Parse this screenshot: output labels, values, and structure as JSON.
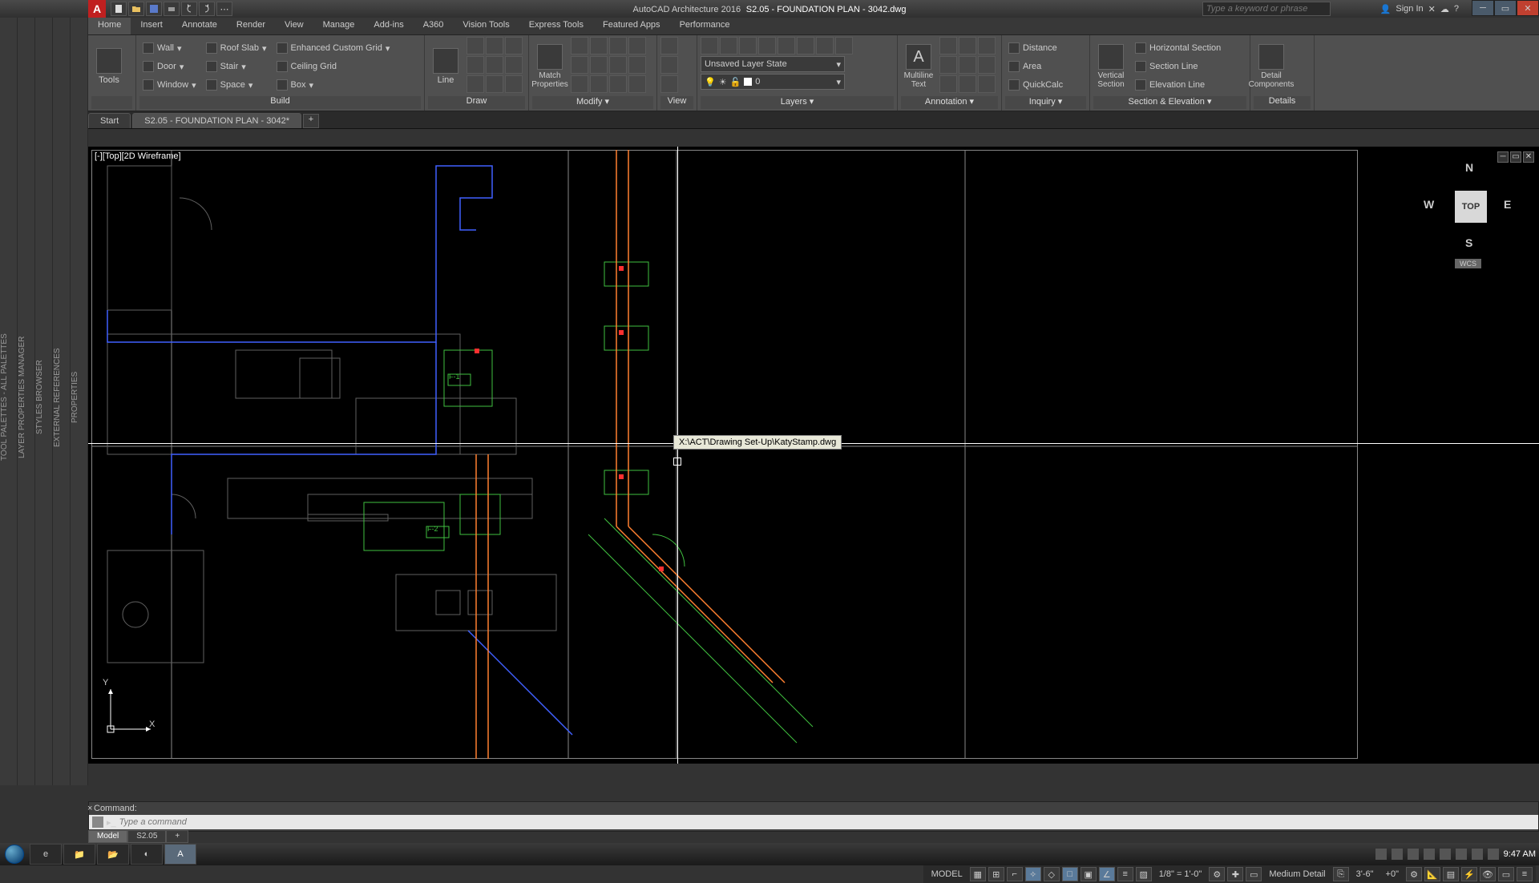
{
  "app": {
    "product": "AutoCAD Architecture 2016",
    "document": "S2.05 - FOUNDATION PLAN - 3042.dwg",
    "search_placeholder": "Type a keyword or phrase",
    "sign_in": "Sign In"
  },
  "ribbon": {
    "tabs": [
      "Home",
      "Insert",
      "Annotate",
      "Render",
      "View",
      "Manage",
      "Add-ins",
      "A360",
      "Vision Tools",
      "Express Tools",
      "Featured Apps",
      "Performance"
    ],
    "active_tab": "Home",
    "panels": {
      "tools": {
        "title": "",
        "big": "Tools"
      },
      "build": {
        "title": "Build",
        "rows": [
          [
            "Wall",
            "Roof Slab",
            "Enhanced Custom Grid"
          ],
          [
            "Door",
            "Stair",
            "Ceiling Grid"
          ],
          [
            "Window",
            "Space",
            "Box"
          ]
        ]
      },
      "draw": {
        "title": "Draw",
        "big": "Line"
      },
      "modify": {
        "title": "Modify ▾",
        "big": "Match Properties"
      },
      "view": {
        "title": "View"
      },
      "layers": {
        "title": "Layers ▾",
        "state": "Unsaved Layer State",
        "current": "0",
        "swatch": "#ffffff"
      },
      "annotation": {
        "title": "Annotation ▾",
        "big": "Multiline Text"
      },
      "inquiry": {
        "title": "Inquiry ▾",
        "items": [
          "Distance",
          "Area",
          "QuickCalc"
        ]
      },
      "section": {
        "title": "Section & Elevation ▾",
        "big": "Vertical Section",
        "items": [
          "Horizontal Section",
          "Section Line",
          "Elevation Line"
        ]
      },
      "details": {
        "title": "Details",
        "big": "Detail Components"
      }
    }
  },
  "doc_tabs": {
    "start": "Start",
    "file": "S2.05 - FOUNDATION PLAN - 3042*"
  },
  "palettes": [
    "TOOL PALETTES - ALL PALETTES",
    "LAYER PROPERTIES MANAGER",
    "STYLES BROWSER",
    "EXTERNAL REFERENCES",
    "PROPERTIES"
  ],
  "viewport": {
    "label": "[-][Top][2D Wireframe]",
    "tooltip": "X:\\ACT\\Drawing Set-Up\\KatyStamp.dwg"
  },
  "navcube": {
    "face": "TOP",
    "n": "N",
    "s": "S",
    "e": "E",
    "w": "W",
    "wcs": "WCS"
  },
  "ucs": {
    "x": "X",
    "y": "Y"
  },
  "callouts": {
    "f1": "F-1",
    "f2": "F-2"
  },
  "command": {
    "history": "Command:",
    "placeholder": "Type a command"
  },
  "layout_tabs": [
    "Model",
    "S2.05"
  ],
  "status": {
    "model": "MODEL",
    "scale": "1/8\" = 1'-0\"",
    "detail": "Medium Detail",
    "elev": "3'-6\"",
    "cut": "+0\""
  },
  "taskbar": {
    "time": "9:47 AM"
  }
}
